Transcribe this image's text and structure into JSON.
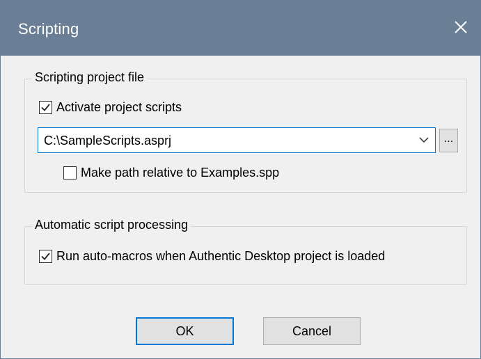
{
  "window": {
    "title": "Scripting"
  },
  "scripting_project_file": {
    "legend": "Scripting project file",
    "activate_label": "Activate project scripts",
    "activate_checked": true,
    "path_value": "C:\\SampleScripts.asprj",
    "browse_label": "...",
    "relative_label": "Make path relative to Examples.spp",
    "relative_checked": false
  },
  "automatic_script_processing": {
    "legend": "Automatic script processing",
    "run_macros_label": "Run auto-macros when Authentic Desktop project is loaded",
    "run_macros_checked": true
  },
  "buttons": {
    "ok": "OK",
    "cancel": "Cancel"
  },
  "icons": {
    "close": "close-icon",
    "check": "checkmark-icon",
    "dropdown": "chevron-down-icon"
  },
  "colors": {
    "titlebar": "#6a7f95",
    "accent": "#0078d7",
    "dialog_bg": "#f0f0f0",
    "button_bg": "#e1e1e1"
  }
}
